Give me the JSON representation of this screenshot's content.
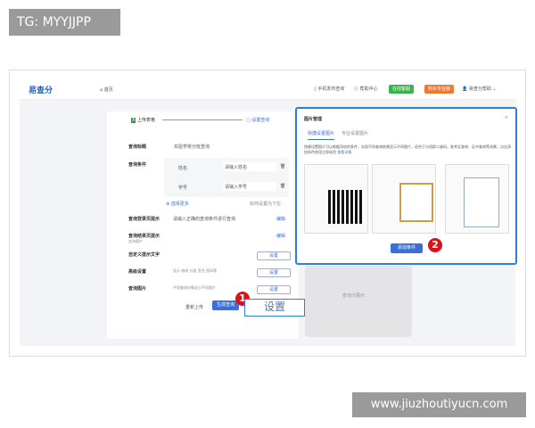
{
  "watermark_top": "TG: MYYJJPP",
  "watermark_bottom": "www.jiuzhoutiyucn.com",
  "header": {
    "logo": "易查分",
    "home": "首页",
    "mobile": "手机发布查询",
    "help": "帮助中心",
    "green_btn": "在线客服",
    "orange_btn": "购买专业版",
    "user": "易查分帮助"
  },
  "steps": {
    "step1": "上传表格",
    "step2": "设置查询"
  },
  "form": {
    "title_label": "查询标题",
    "title_value": "实验学校分班查询",
    "cond_label": "查询条件",
    "cond_rows": [
      {
        "name": "姓名",
        "placeholder": "请输入姓名"
      },
      {
        "name": "学号",
        "placeholder": "请输入学号"
      }
    ],
    "more": "选择更多",
    "dropdown_hint": "如何设置为下拉",
    "login_tip_label": "查询登录页提示",
    "login_tip_value": "请输入正确的查询条件进行查询",
    "edit": "编辑",
    "result_tip_label": "查询结果页提示",
    "result_tip_sub": "支持图片",
    "custom_label": "自定义提示文字",
    "advanced_label": "高级设置",
    "advanced_value": "显示 修改 分组 签名 密码等",
    "image_label": "查询图片",
    "image_value": "不同查询对象显示不同图片",
    "set": "设置",
    "reupload": "重新上传",
    "generate": "生成查询"
  },
  "callout": {
    "label": "设置",
    "num1": "1",
    "num2": "2"
  },
  "modal": {
    "title": "图片管理",
    "close": "×",
    "tabs": [
      "快捷设置图片",
      "专业设置图片"
    ],
    "desc": "快捷设置图片可以根据添加的条件，实现不同查询结果显示不同图片，适合于分班群二维码、准考证查询、证书查询等场景，点击添加条件按钮立即体验",
    "link": "查看详情",
    "add": "添加条件"
  },
  "preview": {
    "caption": "查询分展示"
  },
  "colors": {
    "accent": "#2f7fd6",
    "green": "#3bb34a",
    "orange": "#ee7733",
    "badge": "#d8141b"
  }
}
